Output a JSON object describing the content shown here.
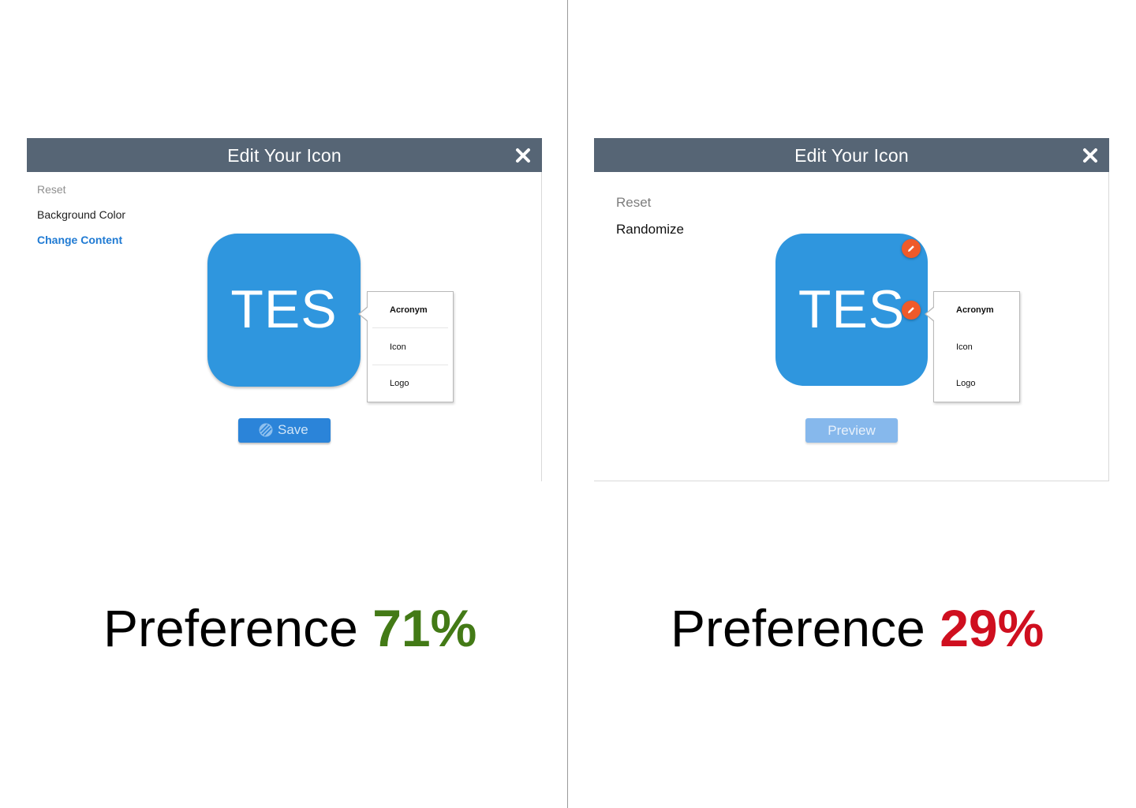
{
  "left_variant": {
    "dialog": {
      "title": "Edit Your Icon",
      "close_icon": "close-x-icon"
    },
    "options": {
      "reset": "Reset",
      "background_color": "Background Color",
      "change_content": "Change Content"
    },
    "icon_preview": {
      "text": "TES",
      "background_color": "#2f96de"
    },
    "content_menu": {
      "items": [
        "Acronym",
        "Icon",
        "Logo"
      ],
      "selected": "Acronym"
    },
    "save_button": {
      "label": "Save",
      "icon": "save-stripes-icon",
      "color": "#2b84d9"
    },
    "preference": {
      "label": "Preference",
      "value": "71%",
      "color": "#437a16"
    }
  },
  "right_variant": {
    "dialog": {
      "title": "Edit Your Icon",
      "close_icon": "close-x-icon"
    },
    "options": {
      "reset": "Reset",
      "randomize": "Randomize"
    },
    "icon_preview": {
      "text": "TES",
      "background_color": "#2f96de",
      "edit_badge_icon": "pencil-icon",
      "edit_badge_color": "#ef5a2a"
    },
    "content_menu": {
      "items": [
        "Acronym",
        "Icon",
        "Logo"
      ],
      "selected": "Acronym"
    },
    "preview_button": {
      "label": "Preview",
      "color": "#86b8ec"
    },
    "preference": {
      "label": "Preference",
      "value": "29%",
      "color": "#cf0f1f"
    }
  },
  "colors": {
    "titlebar": "#566575",
    "accent_blue": "#1f7ad3"
  }
}
